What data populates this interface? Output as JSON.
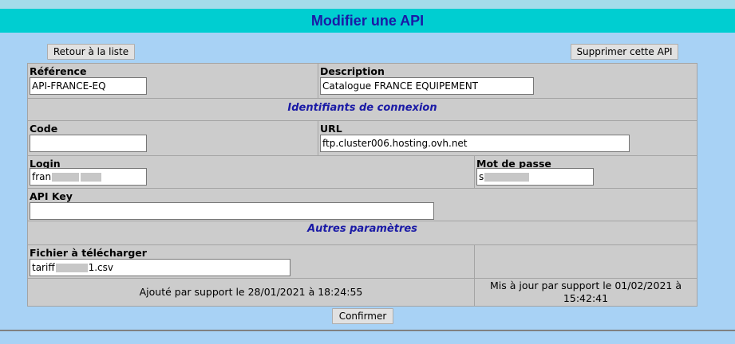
{
  "header": {
    "title": "Modifier une API"
  },
  "toolbar": {
    "back_label": "Retour à la liste",
    "delete_label": "Supprimer cette API"
  },
  "form": {
    "reference": {
      "label": "Référence",
      "value": "API-FRANCE-EQ"
    },
    "description": {
      "label": "Description",
      "value": "Catalogue FRANCE EQUIPEMENT"
    },
    "section_connexion": "Identifiants de connexion",
    "code": {
      "label": "Code",
      "value": ""
    },
    "url": {
      "label": "URL",
      "value": "ftp.cluster006.hosting.ovh.net"
    },
    "login": {
      "label": "Login",
      "value_prefix": "fran",
      "value_suffix": ""
    },
    "password": {
      "label": "Mot de passe",
      "value_prefix": "s",
      "value_suffix": ""
    },
    "api_key": {
      "label": "API Key",
      "value": ""
    },
    "section_other": "Autres paramètres",
    "file": {
      "label": "Fichier à télécharger",
      "value_prefix": "tariff",
      "value_suffix": "1.csv"
    },
    "added_by": "Ajouté par support le 28/01/2021 à 18:24:55",
    "updated_by": "Mis à jour par support le 01/02/2021 à 15:42:41",
    "confirm_label": "Confirmer"
  }
}
